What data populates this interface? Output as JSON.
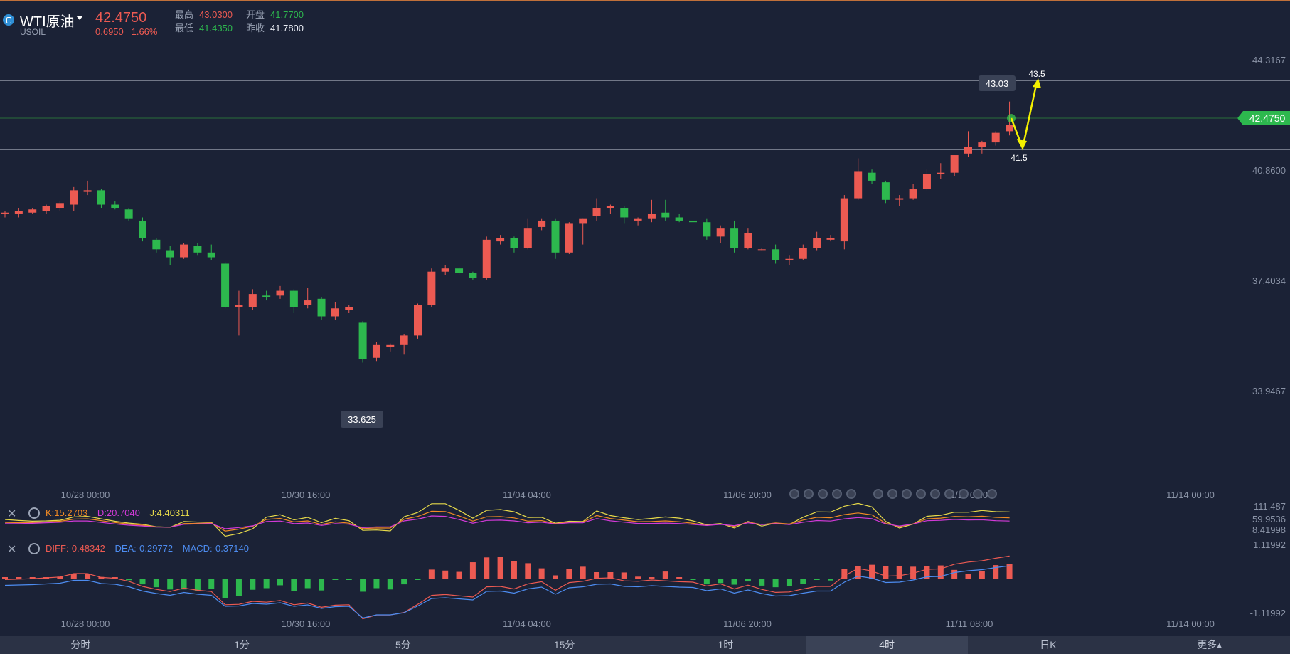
{
  "symbol": {
    "name": "WTI原油",
    "code": "USOIL",
    "icon": "oil-coin-icon"
  },
  "quote": {
    "price": "42.4750",
    "change": "0.6950",
    "change_pct": "1.66%",
    "high_label": "最高",
    "high": "43.0300",
    "open_label": "开盘",
    "open": "41.7700",
    "low_label": "最低",
    "low": "41.4350",
    "prev_label": "昨收",
    "prev": "41.7800"
  },
  "colors": {
    "up": "#ec5a52",
    "down": "#2db84e",
    "background": "#1b2236",
    "accent_price_tag": "#2db84e",
    "arrow": "#f4f000"
  },
  "price_axis": [
    "44.3167",
    "40.8600",
    "37.4034",
    "33.9467"
  ],
  "current_price_tag": "42.4750",
  "annotations": {
    "high_marker": "43.03",
    "low_marker": "33.625",
    "target_up": "43.5",
    "target_down": "41.5"
  },
  "time_axis": [
    "10/28 00:00",
    "10/30 16:00",
    "11/04 04:00",
    "11/06 20:00",
    "11/11 08:00",
    "11/14 00:00"
  ],
  "kdj": {
    "k_label": "K:15.2703",
    "d_label": "D:20.7040",
    "j_label": "J:4.40311",
    "axis": [
      "111.487",
      "59.9536",
      "8.41998"
    ]
  },
  "macd": {
    "diff_label": "DIFF:-0.48342",
    "dea_label": "DEA:-0.29772",
    "macd_label": "MACD:-0.37140",
    "axis": [
      "1.11992",
      "-1.11992"
    ]
  },
  "tabs": [
    "分时",
    "1分",
    "5分",
    "15分",
    "1时",
    "4时",
    "日K",
    "更多▴"
  ],
  "active_tab": "4时",
  "chart_data": {
    "type": "candlestick",
    "ylim": [
      33.0,
      44.6
    ],
    "series": [
      {
        "o": 39.5,
        "h": 39.6,
        "l": 39.4,
        "c": 39.55
      },
      {
        "o": 39.5,
        "h": 39.7,
        "l": 39.4,
        "c": 39.6
      },
      {
        "o": 39.55,
        "h": 39.7,
        "l": 39.5,
        "c": 39.65
      },
      {
        "o": 39.6,
        "h": 39.8,
        "l": 39.5,
        "c": 39.75
      },
      {
        "o": 39.7,
        "h": 39.9,
        "l": 39.6,
        "c": 39.85
      },
      {
        "o": 39.8,
        "h": 40.35,
        "l": 39.6,
        "c": 40.25
      },
      {
        "o": 40.2,
        "h": 40.55,
        "l": 40.1,
        "c": 40.25
      },
      {
        "o": 40.25,
        "h": 40.3,
        "l": 39.7,
        "c": 39.8
      },
      {
        "o": 39.8,
        "h": 39.9,
        "l": 39.65,
        "c": 39.7
      },
      {
        "o": 39.65,
        "h": 39.7,
        "l": 39.3,
        "c": 39.35
      },
      {
        "o": 39.3,
        "h": 39.4,
        "l": 38.65,
        "c": 38.75
      },
      {
        "o": 38.7,
        "h": 38.75,
        "l": 38.3,
        "c": 38.4
      },
      {
        "o": 38.35,
        "h": 38.5,
        "l": 37.9,
        "c": 38.15
      },
      {
        "o": 38.15,
        "h": 38.6,
        "l": 38.1,
        "c": 38.55
      },
      {
        "o": 38.5,
        "h": 38.6,
        "l": 38.2,
        "c": 38.3
      },
      {
        "o": 38.3,
        "h": 38.55,
        "l": 38.05,
        "c": 38.15
      },
      {
        "o": 37.95,
        "h": 38.0,
        "l": 36.55,
        "c": 36.6
      },
      {
        "o": 36.6,
        "h": 37.1,
        "l": 35.7,
        "c": 36.65
      },
      {
        "o": 36.6,
        "h": 37.15,
        "l": 36.5,
        "c": 37.0
      },
      {
        "o": 36.95,
        "h": 37.1,
        "l": 36.8,
        "c": 36.9
      },
      {
        "o": 36.95,
        "h": 37.25,
        "l": 36.85,
        "c": 37.1
      },
      {
        "o": 37.1,
        "h": 37.15,
        "l": 36.4,
        "c": 36.6
      },
      {
        "o": 36.65,
        "h": 37.2,
        "l": 36.55,
        "c": 36.8
      },
      {
        "o": 36.85,
        "h": 36.9,
        "l": 36.2,
        "c": 36.3
      },
      {
        "o": 36.3,
        "h": 36.75,
        "l": 36.2,
        "c": 36.55
      },
      {
        "o": 36.5,
        "h": 36.65,
        "l": 36.4,
        "c": 36.6
      },
      {
        "o": 36.1,
        "h": 36.15,
        "l": 34.85,
        "c": 34.95
      },
      {
        "o": 35.0,
        "h": 35.5,
        "l": 34.9,
        "c": 35.4
      },
      {
        "o": 35.35,
        "h": 35.45,
        "l": 35.2,
        "c": 35.4
      },
      {
        "o": 35.4,
        "h": 35.75,
        "l": 35.1,
        "c": 35.7
      },
      {
        "o": 35.7,
        "h": 36.7,
        "l": 35.6,
        "c": 36.65
      },
      {
        "o": 36.65,
        "h": 37.8,
        "l": 36.6,
        "c": 37.7
      },
      {
        "o": 37.7,
        "h": 37.9,
        "l": 37.6,
        "c": 37.8
      },
      {
        "o": 37.8,
        "h": 37.85,
        "l": 37.6,
        "c": 37.65
      },
      {
        "o": 37.65,
        "h": 37.7,
        "l": 37.45,
        "c": 37.5
      },
      {
        "o": 37.5,
        "h": 38.8,
        "l": 37.45,
        "c": 38.7
      },
      {
        "o": 38.65,
        "h": 38.85,
        "l": 38.55,
        "c": 38.75
      },
      {
        "o": 38.75,
        "h": 38.8,
        "l": 38.3,
        "c": 38.45
      },
      {
        "o": 38.45,
        "h": 39.35,
        "l": 38.4,
        "c": 39.05
      },
      {
        "o": 39.1,
        "h": 39.35,
        "l": 39.0,
        "c": 39.3
      },
      {
        "o": 39.3,
        "h": 39.35,
        "l": 38.1,
        "c": 38.3
      },
      {
        "o": 38.3,
        "h": 39.25,
        "l": 38.25,
        "c": 39.2
      },
      {
        "o": 39.2,
        "h": 39.35,
        "l": 38.55,
        "c": 39.35
      },
      {
        "o": 39.45,
        "h": 40.0,
        "l": 39.3,
        "c": 39.7
      },
      {
        "o": 39.7,
        "h": 39.8,
        "l": 39.5,
        "c": 39.75
      },
      {
        "o": 39.7,
        "h": 39.75,
        "l": 39.2,
        "c": 39.4
      },
      {
        "o": 39.3,
        "h": 39.4,
        "l": 39.15,
        "c": 39.35
      },
      {
        "o": 39.35,
        "h": 39.95,
        "l": 39.25,
        "c": 39.5
      },
      {
        "o": 39.55,
        "h": 39.95,
        "l": 39.3,
        "c": 39.4
      },
      {
        "o": 39.4,
        "h": 39.5,
        "l": 39.25,
        "c": 39.3
      },
      {
        "o": 39.3,
        "h": 39.4,
        "l": 39.2,
        "c": 39.25
      },
      {
        "o": 39.25,
        "h": 39.35,
        "l": 38.7,
        "c": 38.8
      },
      {
        "o": 38.8,
        "h": 39.15,
        "l": 38.6,
        "c": 39.05
      },
      {
        "o": 39.05,
        "h": 39.3,
        "l": 38.3,
        "c": 38.45
      },
      {
        "o": 38.45,
        "h": 39.05,
        "l": 38.4,
        "c": 38.9
      },
      {
        "o": 38.4,
        "h": 38.45,
        "l": 38.35,
        "c": 38.4
      },
      {
        "o": 38.4,
        "h": 38.55,
        "l": 37.95,
        "c": 38.05
      },
      {
        "o": 38.05,
        "h": 38.2,
        "l": 37.9,
        "c": 38.1
      },
      {
        "o": 38.1,
        "h": 38.55,
        "l": 38.05,
        "c": 38.45
      },
      {
        "o": 38.45,
        "h": 38.95,
        "l": 38.35,
        "c": 38.75
      },
      {
        "o": 38.7,
        "h": 38.85,
        "l": 38.65,
        "c": 38.75
      },
      {
        "o": 38.65,
        "h": 40.1,
        "l": 38.4,
        "c": 40.0
      },
      {
        "o": 40.0,
        "h": 41.25,
        "l": 39.95,
        "c": 40.85
      },
      {
        "o": 40.8,
        "h": 40.9,
        "l": 40.45,
        "c": 40.55
      },
      {
        "o": 40.5,
        "h": 40.55,
        "l": 39.85,
        "c": 39.95
      },
      {
        "o": 40.0,
        "h": 40.1,
        "l": 39.75,
        "c": 40.0
      },
      {
        "o": 40.0,
        "h": 40.45,
        "l": 39.95,
        "c": 40.3
      },
      {
        "o": 40.3,
        "h": 40.9,
        "l": 40.25,
        "c": 40.75
      },
      {
        "o": 40.75,
        "h": 41.1,
        "l": 40.6,
        "c": 40.8
      },
      {
        "o": 40.8,
        "h": 41.35,
        "l": 40.7,
        "c": 41.35
      },
      {
        "o": 41.4,
        "h": 42.1,
        "l": 41.3,
        "c": 41.6
      },
      {
        "o": 41.6,
        "h": 41.8,
        "l": 41.4,
        "c": 41.75
      },
      {
        "o": 41.75,
        "h": 42.1,
        "l": 41.65,
        "c": 42.05
      },
      {
        "o": 42.1,
        "h": 43.03,
        "l": 41.97,
        "c": 42.3
      }
    ]
  }
}
